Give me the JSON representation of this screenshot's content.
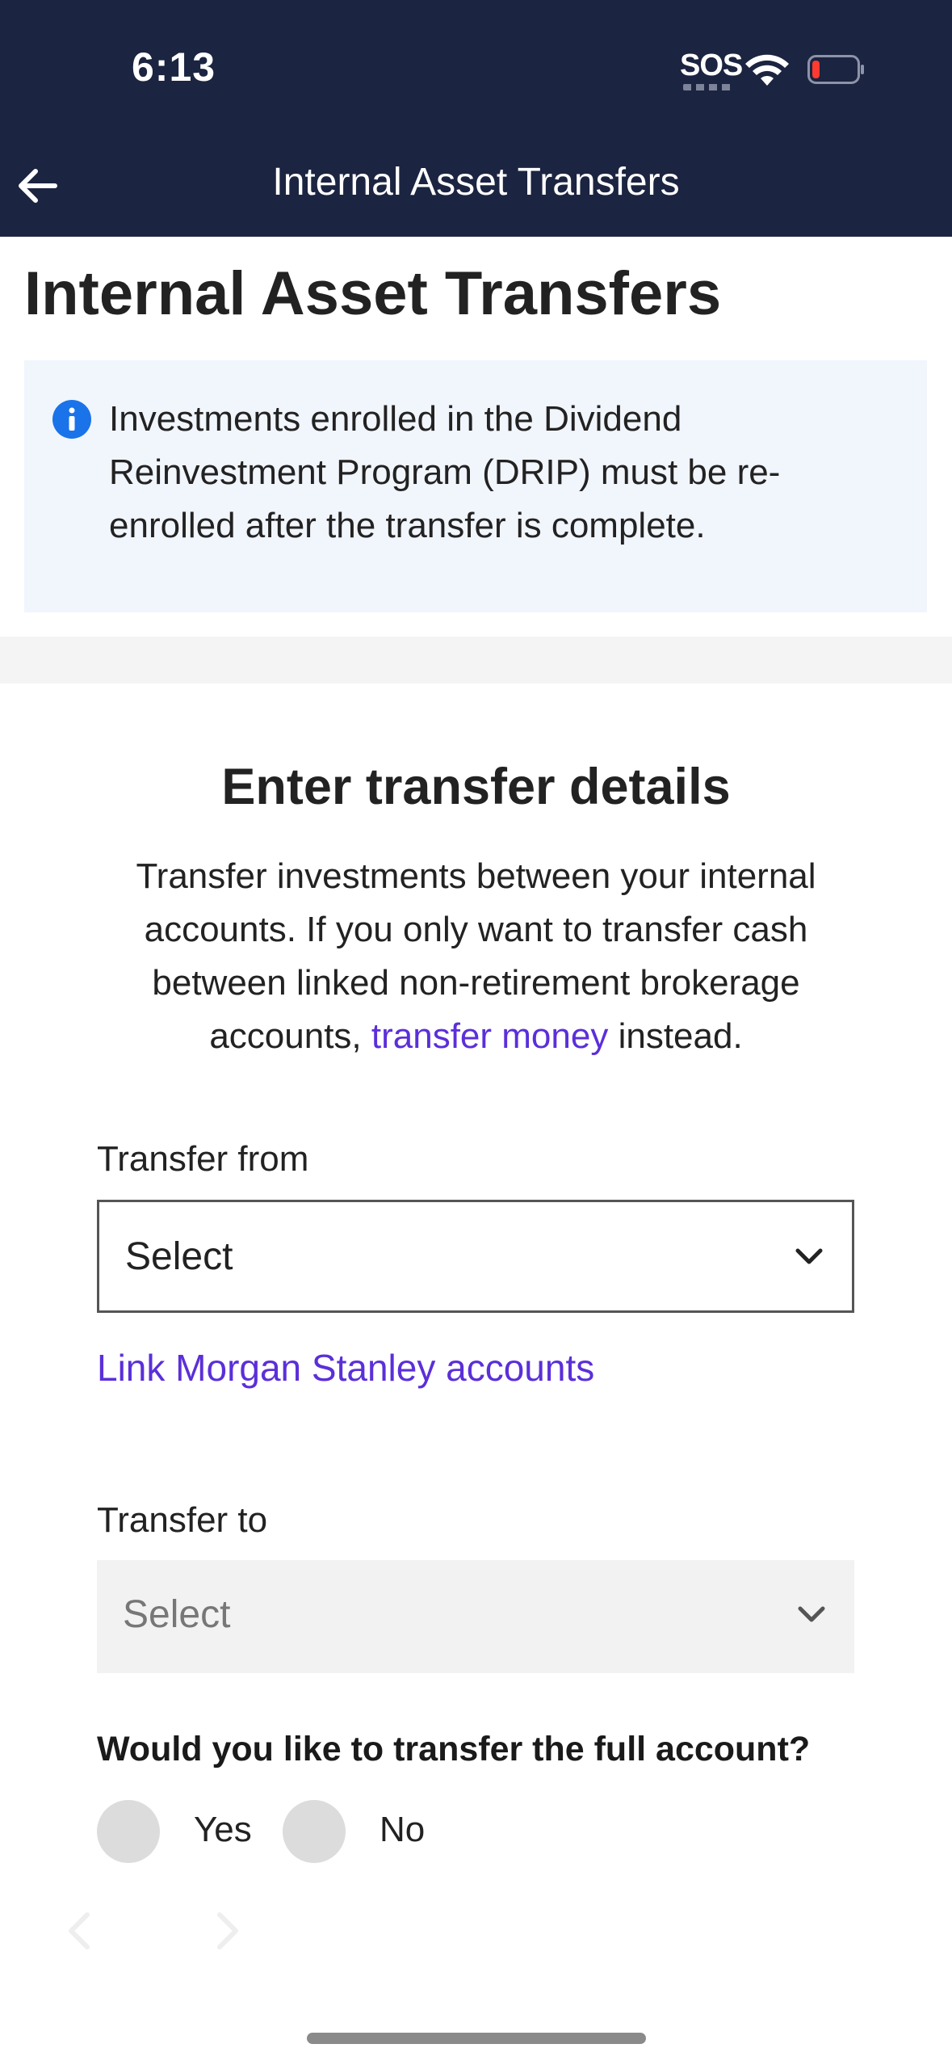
{
  "status_bar": {
    "time": "6:13",
    "carrier": "SOS",
    "icons": [
      "wifi-icon",
      "battery-icon"
    ]
  },
  "nav": {
    "title": "Internal Asset Transfers",
    "back_icon": "arrow-left-icon"
  },
  "page": {
    "title": "Internal Asset Transfers"
  },
  "info_banner": {
    "icon": "info-icon",
    "text": "Investments enrolled in the Dividend Reinvestment Program (DRIP) must be re-enrolled after the transfer is complete."
  },
  "details": {
    "title": "Enter transfer details",
    "description_before": "Transfer investments between your internal accounts. If you only want to transfer cash between linked non-retirement brokerage accounts, ",
    "description_link": "transfer money",
    "description_after": " instead."
  },
  "transfer_from": {
    "label": "Transfer from",
    "value": "Select"
  },
  "link_accounts": "Link Morgan Stanley accounts",
  "transfer_to": {
    "label": "Transfer to",
    "value": "Select"
  },
  "full_account": {
    "question": "Would you like to transfer the full account?",
    "options": [
      "Yes",
      "No"
    ]
  },
  "colors": {
    "header_bg": "#1b2440",
    "link": "#5b2fd9",
    "info_bg": "#f1f5fc",
    "info_icon": "#1a73e8"
  }
}
